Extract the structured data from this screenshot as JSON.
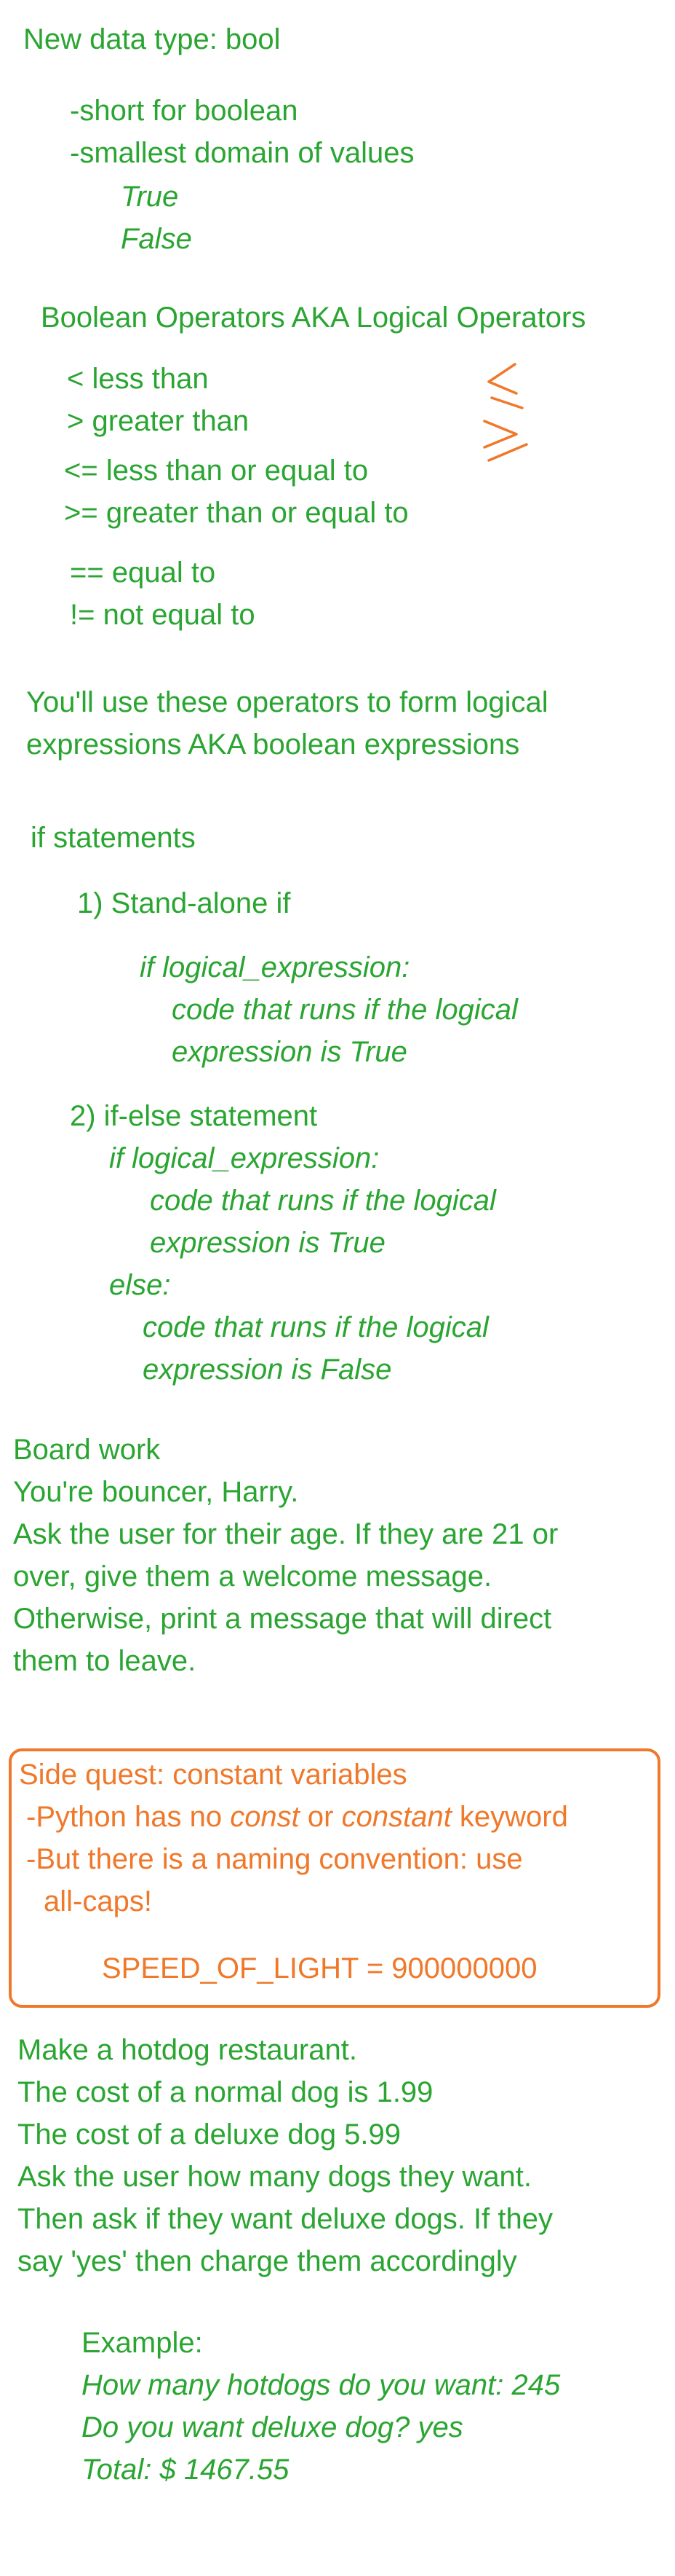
{
  "bool_section": {
    "title": "New data type: bool",
    "points": [
      "-short for boolean",
      "-smallest domain of values"
    ],
    "values": [
      "True",
      "False"
    ]
  },
  "operators": {
    "title": "Boolean Operators AKA Logical Operators",
    "items": [
      "<   less than",
      ">   greater than",
      "<= less than or equal to",
      ">= greater than or equal to",
      "== equal to",
      "!=  not equal to"
    ],
    "ink_symbols": [
      "≤",
      "≥"
    ]
  },
  "expressions_note": {
    "line1": "You'll use these operators to form logical",
    "line2": "expressions AKA boolean expressions"
  },
  "if_section": {
    "title": "if statements",
    "standalone": {
      "label": "1) Stand-alone if",
      "lines": [
        "if logical_expression:",
        "code that runs if the logical",
        "expression is True"
      ]
    },
    "if_else": {
      "label": "2) if-else statement",
      "lines": [
        "if logical_expression:",
        "code that runs if the logical",
        "expression is True",
        "else:",
        "code that runs if the logical",
        "expression is False"
      ]
    }
  },
  "board_work": {
    "lines": [
      "Board work",
      "You're bouncer, Harry.",
      "Ask the user for their age. If they are 21 or",
      "over, give them a welcome message.",
      "Otherwise, print a message that will direct",
      "them to leave."
    ]
  },
  "side_quest": {
    "title": "Side quest: constant variables",
    "line1_pre": "-Python has no ",
    "line1_kw1": "const",
    "line1_mid": " or ",
    "line1_kw2": "constant",
    "line1_post": " keyword",
    "line2": "-But there is a naming convention: use",
    "line3": "all-caps!",
    "example": "SPEED_OF_LIGHT = 900000000"
  },
  "hotdog": {
    "lines": [
      "Make a hotdog restaurant.",
      "The cost of a normal dog is 1.99",
      "The cost of a deluxe dog 5.99",
      "Ask the user how many dogs they want.",
      "Then ask if they want deluxe dogs. If they",
      "say 'yes' then charge them accordingly"
    ],
    "example_label": "Example:",
    "example_lines": [
      "How many hotdogs do you want: 245",
      "Do you want deluxe dog? yes",
      "Total: $ 1467.55"
    ]
  },
  "colors": {
    "text": "#2aa532",
    "accent": "#f0782a",
    "background": "#ffffff"
  }
}
